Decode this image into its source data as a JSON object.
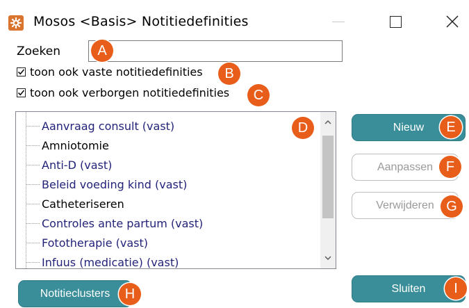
{
  "window": {
    "title": "Mosos <Basis> Notitiedefinities",
    "controls": {
      "minimize_icon": "minimize-icon",
      "maximize_icon": "maximize-icon",
      "close_icon": "close-icon"
    }
  },
  "search": {
    "label": "Zoeken",
    "value": "",
    "placeholder": ""
  },
  "checkboxes": [
    {
      "label": "toon ook vaste notitiedefinities",
      "checked": true
    },
    {
      "label": "toon ook verborgen notitiedefinities",
      "checked": true
    }
  ],
  "definitions_list": {
    "items": [
      {
        "label": "Aanvraag consult (vast)",
        "type": "fixed"
      },
      {
        "label": "Amniotomie",
        "type": "user"
      },
      {
        "label": "Anti-D (vast)",
        "type": "fixed"
      },
      {
        "label": "Beleid voeding kind (vast)",
        "type": "fixed"
      },
      {
        "label": "Catheteriseren",
        "type": "user"
      },
      {
        "label": "Controles ante partum (vast)",
        "type": "fixed"
      },
      {
        "label": "Fototherapie (vast)",
        "type": "fixed"
      },
      {
        "label": "Infuus (medicatie) (vast)",
        "type": "fixed"
      }
    ]
  },
  "buttons": {
    "new": "Nieuw",
    "edit": "Aanpassen",
    "delete": "Verwijderen",
    "clusters": "Notitieclusters",
    "close": "Sluiten"
  },
  "markers": [
    "A",
    "B",
    "C",
    "D",
    "E",
    "F",
    "G",
    "H",
    "I"
  ],
  "colors": {
    "accent": "#3a8e99",
    "marker": "#e85d1a",
    "fixed_item_text": "#23237a",
    "app_icon": "#d9732e"
  }
}
